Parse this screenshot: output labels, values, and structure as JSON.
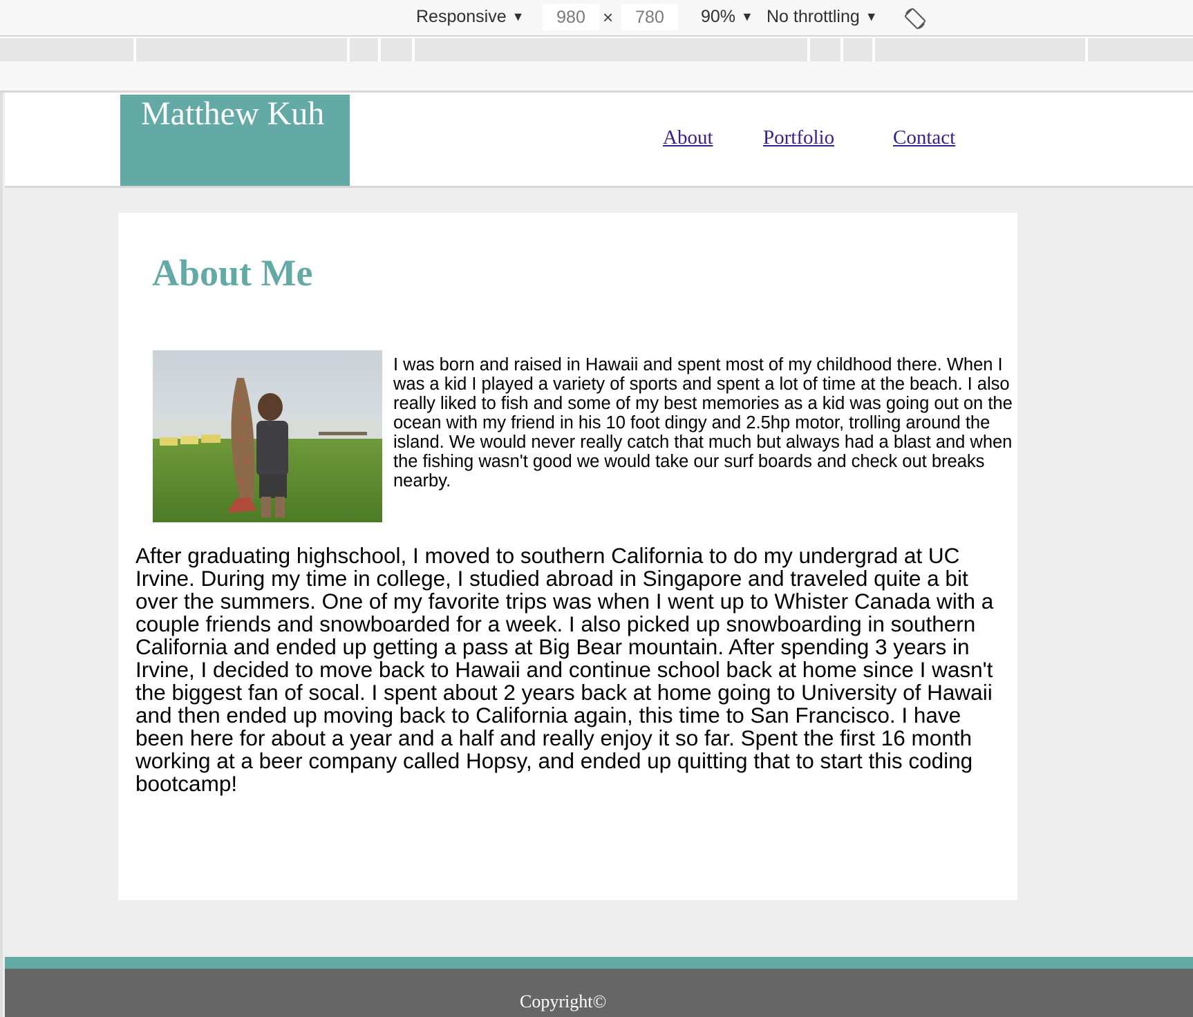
{
  "devtools": {
    "device_mode": "Responsive",
    "width": "980",
    "times": "×",
    "height": "780",
    "zoom": "90%",
    "throttling": "No throttling",
    "caret": "▼",
    "rotate_icon": "rotate-icon"
  },
  "site": {
    "logo": "Matthew Kuh",
    "nav": [
      {
        "label": "About"
      },
      {
        "label": "Portfolio"
      },
      {
        "label": "Contact"
      }
    ]
  },
  "main": {
    "title": "About Me",
    "intro": "I was born and raised in Hawaii and spent most of my childhood there. When I was a kid I played a variety of sports and spent a lot of time at the beach. I also really liked to fish and some of my best memories as a kid was going out on the ocean with my friend in his 10 foot dingy and 2.5hp motor, trolling around the island. We would never really catch that much but always had a blast and when the fishing wasn't good we would take our surf boards and check out breaks nearby.",
    "story": "After graduating highschool, I moved to southern California to do my undergrad at UC Irvine. During my time in college, I studied abroad in Singapore and traveled quite a bit over the summers. One of my favorite trips was when I went up to Whister Canada with a couple friends and snowboarded for a week. I also picked up snowboarding in southern California and ended up getting a pass at Big Bear mountain. After spending 3 years in Irvine, I decided to move back to Hawaii and continue school back at home since I wasn't the biggest fan of socal. I spent about 2 years back at home going to University of Hawaii and then ended up moving back to California again, this time to San Francisco. I have been here for about a year and a half and really enjoy it so far. Spent the first 16 month working at a beer company called Hopsy, and ended up quitting that to start this coding bootcamp!"
  },
  "footer": {
    "copyright": "Copyright©"
  },
  "colors": {
    "accent": "#63aaa6",
    "link": "#3b1f8f",
    "footer": "#666666",
    "page_bg": "#eeeeee"
  }
}
